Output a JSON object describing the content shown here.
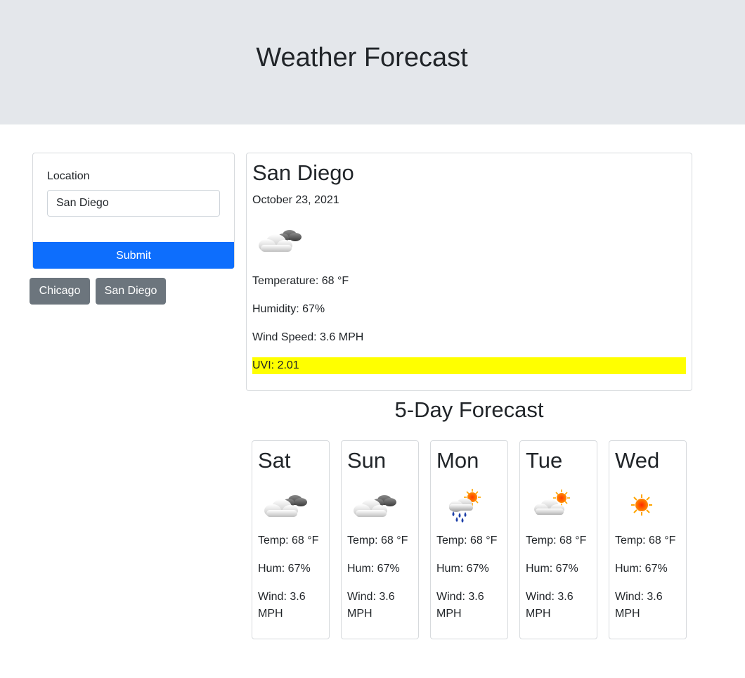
{
  "header": {
    "title": "Weather Forecast"
  },
  "search": {
    "label": "Location",
    "value": "San Diego",
    "submit_label": "Submit",
    "history": [
      "Chicago",
      "San Diego"
    ]
  },
  "current": {
    "city": "San Diego",
    "date": "October 23, 2021",
    "icon": "partly-cloudy-icon",
    "temperature": "Temperature: 68 °F",
    "humidity": "Humidity: 67%",
    "wind": "Wind Speed: 3.6 MPH",
    "uvi": "UVI: 2.01",
    "uvi_color": "#ffff00"
  },
  "forecast": {
    "title": "5-Day Forecast",
    "days": [
      {
        "day": "Sat",
        "icon": "cloudy-icon",
        "temp": "Temp: 68 °F",
        "hum": "Hum: 67%",
        "wind": "Wind: 3.6 MPH"
      },
      {
        "day": "Sun",
        "icon": "cloudy-icon",
        "temp": "Temp: 68 °F",
        "hum": "Hum: 67%",
        "wind": "Wind: 3.6 MPH"
      },
      {
        "day": "Mon",
        "icon": "rain-sun-icon",
        "temp": "Temp: 68 °F",
        "hum": "Hum: 67%",
        "wind": "Wind: 3.6 MPH"
      },
      {
        "day": "Tue",
        "icon": "partly-sunny-icon",
        "temp": "Temp: 68 °F",
        "hum": "Hum: 67%",
        "wind": "Wind: 3.6 MPH"
      },
      {
        "day": "Wed",
        "icon": "sun-icon",
        "temp": "Temp: 68 °F",
        "hum": "Hum: 67%",
        "wind": "Wind: 3.6 MPH"
      }
    ]
  },
  "colors": {
    "primary": "#0d6efd",
    "secondary": "#6c757d",
    "header_bg": "#e4e7eb"
  }
}
